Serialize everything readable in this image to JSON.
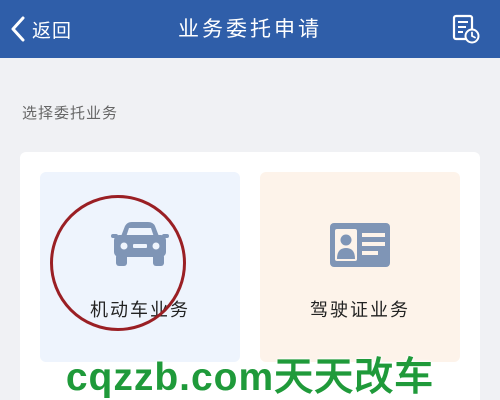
{
  "header": {
    "back_label": "返回",
    "title": "业务委托申请",
    "history_icon": "document-clock-icon"
  },
  "section_label": "选择委托业务",
  "cards": [
    {
      "label": "机动车业务",
      "icon": "car-icon",
      "background": "#eef4fd"
    },
    {
      "label": "驾驶证业务",
      "icon": "id-card-icon",
      "background": "#fdf3ea"
    }
  ],
  "watermark": "cqzzb.com天天改车",
  "colors": {
    "header": "#2f5ea9",
    "icon": "#7f95b6",
    "highlight": "#9a1f24",
    "watermark": "#1f9a3a"
  }
}
